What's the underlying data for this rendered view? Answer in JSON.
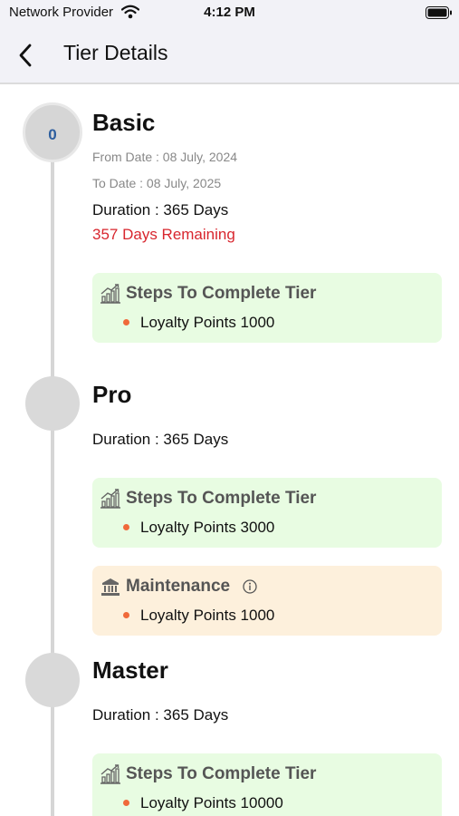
{
  "status_bar": {
    "carrier": "Network Provider",
    "time": "4:12 PM",
    "icons": [
      "wifi-icon",
      "battery-icon"
    ]
  },
  "nav": {
    "title": "Tier Details",
    "back_icon": "chevron-left-icon"
  },
  "colors": {
    "steps_card_bg": "#e8fce2",
    "maintenance_card_bg": "#fdf0dc",
    "remaining_text": "#d8262e",
    "bullet": "#f0693a",
    "tier_level_text": "#2d5e9e"
  },
  "tiers": [
    {
      "level": "0",
      "name": "Basic",
      "from_date": "From Date : 08 July, 2024",
      "to_date": "To Date : 08 July, 2025",
      "duration": "Duration : 365 Days",
      "remaining": "357 Days Remaining",
      "steps": {
        "title": "Steps To Complete Tier",
        "icon": "growth-chart-icon",
        "item": "Loyalty Points 1000"
      }
    },
    {
      "name": "Pro",
      "duration": "Duration : 365 Days",
      "steps": {
        "title": "Steps To Complete Tier",
        "icon": "growth-chart-icon",
        "item": "Loyalty Points 3000"
      },
      "maintenance": {
        "title": "Maintenance",
        "icon": "building-icon",
        "info_icon": "info-icon",
        "item": "Loyalty Points 1000"
      }
    },
    {
      "name": "Master",
      "duration": "Duration : 365 Days",
      "steps": {
        "title": "Steps To Complete Tier",
        "icon": "growth-chart-icon",
        "item": "Loyalty Points 10000"
      }
    }
  ]
}
